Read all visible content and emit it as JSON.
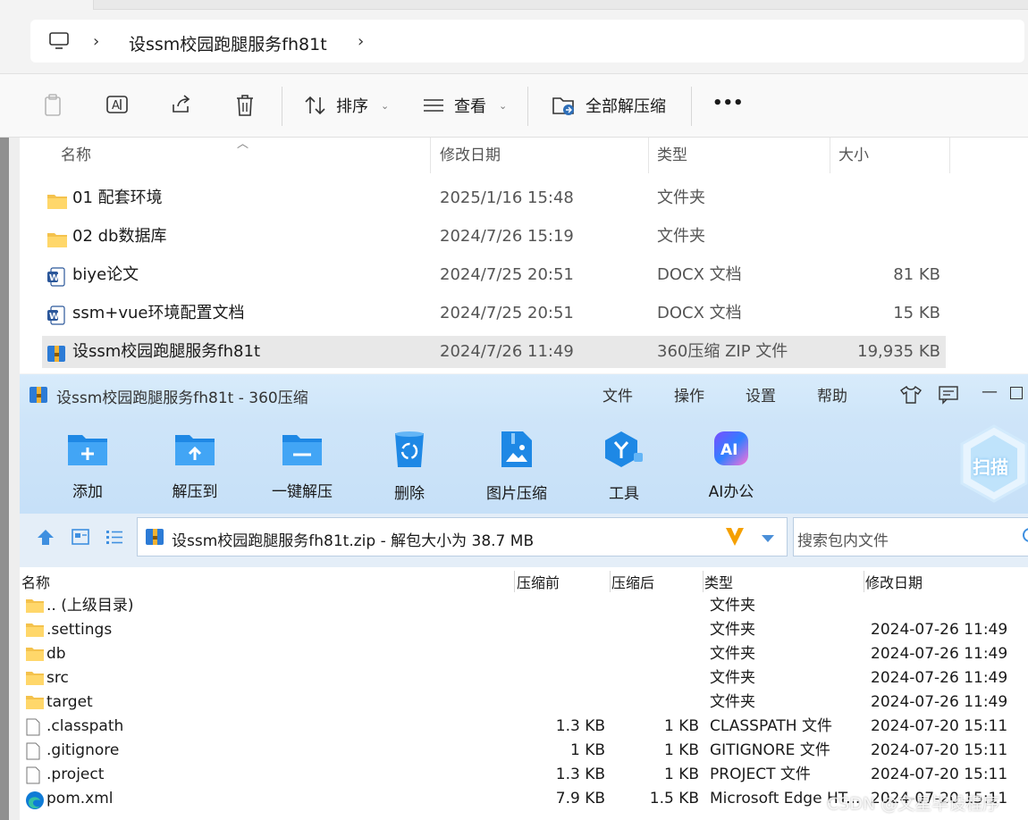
{
  "explorer": {
    "breadcrumb": "设ssm校园跑腿服务fh81t",
    "toolbar": {
      "sort_label": "排序",
      "view_label": "查看",
      "extract_all_label": "全部解压缩",
      "more_label": "•••"
    },
    "columns": {
      "name": "名称",
      "modified": "修改日期",
      "type": "类型",
      "size": "大小"
    },
    "files": [
      {
        "name": "01 配套环境",
        "modified": "2025/1/16 15:48",
        "type": "文件夹",
        "size": "",
        "icon": "folder-icon"
      },
      {
        "name": "02 db数据库",
        "modified": "2024/7/26 15:19",
        "type": "文件夹",
        "size": "",
        "icon": "folder-icon"
      },
      {
        "name": "biye论文",
        "modified": "2024/7/25 20:51",
        "type": "DOCX 文档",
        "size": "81 KB",
        "icon": "word-doc-icon"
      },
      {
        "name": "ssm+vue环境配置文档",
        "modified": "2024/7/25 20:51",
        "type": "DOCX 文档",
        "size": "15 KB",
        "icon": "word-doc-icon"
      },
      {
        "name": "设ssm校园跑腿服务fh81t",
        "modified": "2024/7/26 11:49",
        "type": "360压缩 ZIP 文件",
        "size": "19,935 KB",
        "icon": "zip-archive-icon",
        "selected": true
      }
    ]
  },
  "z360": {
    "title": "设ssm校园跑腿服务fh81t - 360压缩",
    "menu": [
      "文件",
      "操作",
      "设置",
      "帮助"
    ],
    "ribbon": [
      {
        "label": "添加",
        "icon": "add-folder-icon"
      },
      {
        "label": "解压到",
        "icon": "extract-to-icon"
      },
      {
        "label": "一键解压",
        "icon": "one-click-extract-icon"
      },
      {
        "label": "删除",
        "icon": "recycle-bin-icon"
      },
      {
        "label": "图片压缩",
        "icon": "image-compress-icon"
      },
      {
        "label": "工具",
        "icon": "tools-icon"
      },
      {
        "label": "AI办公",
        "icon": "ai-office-icon"
      }
    ],
    "scan_label": "扫描",
    "address": "设ssm校园跑腿服务fh81t.zip - 解包大小为 38.7 MB",
    "search_placeholder": "搜索包内文件",
    "columns": {
      "name": "名称",
      "before": "压缩前",
      "after": "压缩后",
      "type": "类型",
      "modified": "修改日期"
    },
    "rows": [
      {
        "name": ".. (上级目录)",
        "before": "",
        "after": "",
        "type": "文件夹",
        "modified": "",
        "icon": "folder-icon"
      },
      {
        "name": ".settings",
        "before": "",
        "after": "",
        "type": "文件夹",
        "modified": "2024-07-26 11:49",
        "icon": "folder-icon"
      },
      {
        "name": "db",
        "before": "",
        "after": "",
        "type": "文件夹",
        "modified": "2024-07-26 11:49",
        "icon": "folder-icon"
      },
      {
        "name": "src",
        "before": "",
        "after": "",
        "type": "文件夹",
        "modified": "2024-07-26 11:49",
        "icon": "folder-icon"
      },
      {
        "name": "target",
        "before": "",
        "after": "",
        "type": "文件夹",
        "modified": "2024-07-26 11:49",
        "icon": "folder-icon"
      },
      {
        "name": ".classpath",
        "before": "1.3 KB",
        "after": "1 KB",
        "type": "CLASSPATH 文件",
        "modified": "2024-07-20 15:11",
        "icon": "file-icon"
      },
      {
        "name": ".gitignore",
        "before": "1 KB",
        "after": "1 KB",
        "type": "GITIGNORE 文件",
        "modified": "2024-07-20 15:11",
        "icon": "file-icon"
      },
      {
        "name": ".project",
        "before": "1.3 KB",
        "after": "1 KB",
        "type": "PROJECT 文件",
        "modified": "2024-07-20 15:11",
        "icon": "file-icon"
      },
      {
        "name": "pom.xml",
        "before": "7.9 KB",
        "after": "1.5 KB",
        "type": "Microsoft Edge HT...",
        "modified": "2024-07-20 15:11",
        "icon": "edge-icon"
      }
    ]
  },
  "watermark": "CSDN @文星毕设程序"
}
